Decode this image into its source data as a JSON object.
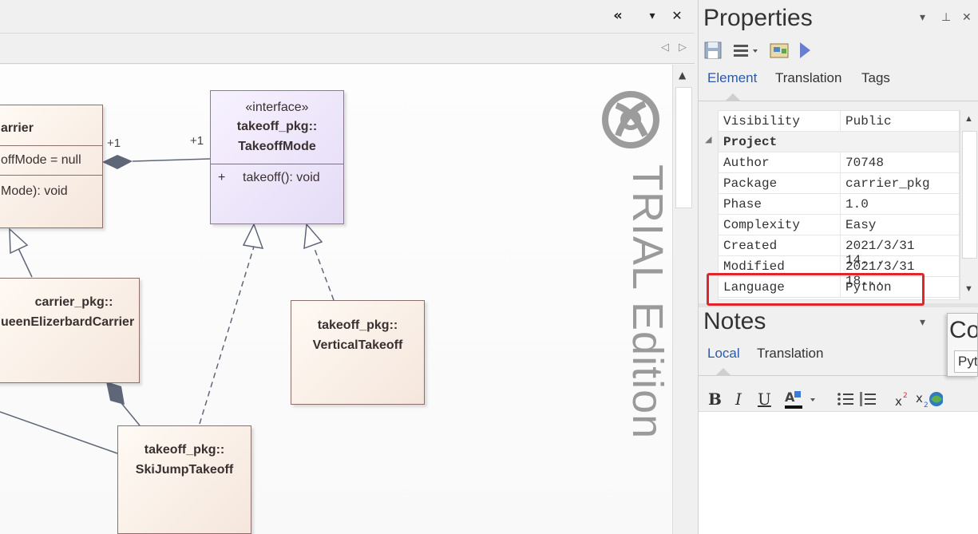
{
  "diagram": {
    "toolbar": {
      "collapse_icon": "«",
      "dropdown_icon": "▾",
      "close_icon": "✕"
    },
    "tab_nav": {
      "prev": "◁",
      "next": "▷"
    },
    "classes": {
      "carrier": {
        "name": "arrier",
        "attribute": "offMode = null",
        "operation": "Mode): void"
      },
      "interface": {
        "stereotype": "«interface»",
        "name_line1": "takeoff_pkg::",
        "name_line2": "TakeoffMode",
        "op_visibility": "+",
        "operation": "takeoff(): void"
      },
      "queen": {
        "name_line1": "carrier_pkg::",
        "name_line2": "ueenElizerbardCarrier"
      },
      "vertical": {
        "name_line1": "takeoff_pkg::",
        "name_line2": "VerticalTakeoff"
      },
      "skijump": {
        "name_line1": "takeoff_pkg::",
        "name_line2": "SkiJumpTakeoff"
      }
    },
    "multiplicity_left": "+1",
    "multiplicity_right": "+1",
    "watermark": "TRIAL Edition"
  },
  "properties": {
    "title": "Properties",
    "controls": {
      "dropdown": "▾",
      "pin": "⊥",
      "close": "✕"
    },
    "toolbar_icons": [
      "save-icon",
      "list-icon",
      "dropdown-icon",
      "window-icon",
      "run-icon"
    ],
    "tabs": [
      "Element",
      "Translation",
      "Tags"
    ],
    "active_tab": "Element",
    "rows": [
      {
        "key": "Visibility",
        "value": "Public"
      },
      {
        "category": "Project"
      },
      {
        "key": "Author",
        "value": "70748"
      },
      {
        "key": "Package",
        "value": "carrier_pkg"
      },
      {
        "key": "Phase",
        "value": "1.0"
      },
      {
        "key": "Complexity",
        "value": "Easy"
      },
      {
        "key": "Created",
        "value": "2021/3/31 14..."
      },
      {
        "key": "Modified",
        "value": "2021/3/31 18..."
      },
      {
        "key": "Language",
        "value": "Python"
      }
    ],
    "collapse_icon": "◢"
  },
  "notes": {
    "title": "Notes",
    "dropdown": "▾",
    "tabs": [
      "Local",
      "Translation"
    ],
    "active_tab": "Local",
    "format_buttons": {
      "bold": "B",
      "italic": "I",
      "underline": "U"
    }
  },
  "popup": {
    "title": "Co",
    "value": "Pytl"
  },
  "colors": {
    "highlight": "#e0262a",
    "accent": "#2a5aa8",
    "class_fill": "#f5e6dc",
    "interface_fill": "#e4dcf6"
  }
}
